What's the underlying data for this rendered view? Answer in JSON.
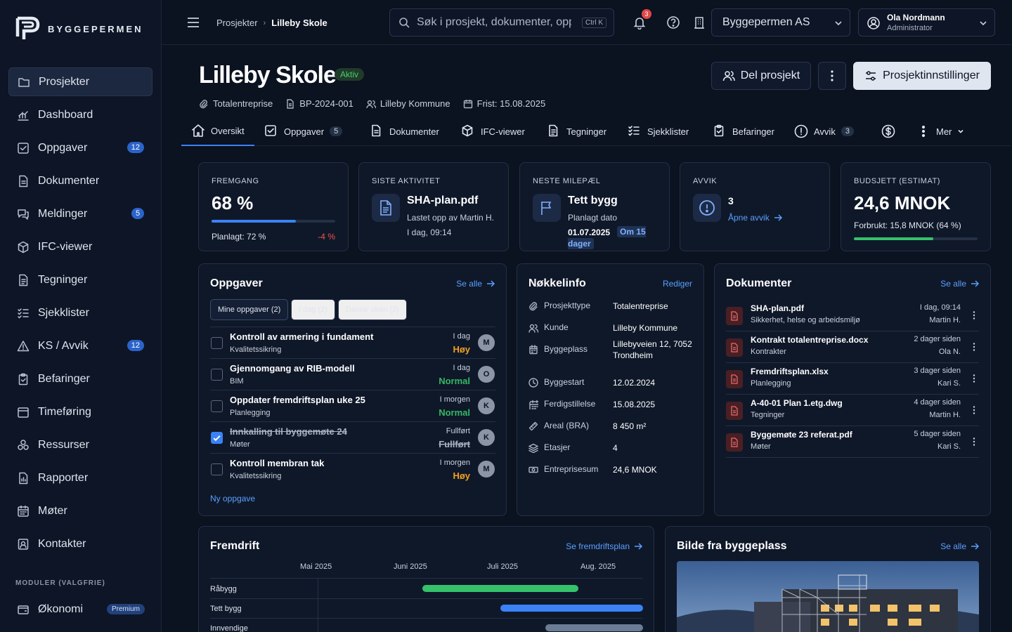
{
  "brand": {
    "name": "BYGGEPERMEN"
  },
  "sidebar": {
    "items": [
      {
        "label": "Prosjekter",
        "icon": "folder-icon",
        "active": true
      },
      {
        "label": "Dashboard",
        "icon": "chart-icon"
      },
      {
        "label": "Oppgaver",
        "icon": "checkbox-icon",
        "badge": "12"
      },
      {
        "label": "Dokumenter",
        "icon": "document-icon"
      },
      {
        "label": "Meldinger",
        "icon": "chat-icon",
        "badge": "5"
      },
      {
        "label": "IFC-viewer",
        "icon": "cube-icon"
      },
      {
        "label": "Tegninger",
        "icon": "drawing-icon"
      },
      {
        "label": "Sjekklister",
        "icon": "checklist-icon"
      },
      {
        "label": "KS / Avvik",
        "icon": "warning-icon",
        "badge": "12"
      },
      {
        "label": "Befaringer",
        "icon": "clipboard-icon"
      },
      {
        "label": "Timeføring",
        "icon": "timesheet-icon"
      },
      {
        "label": "Ressurser",
        "icon": "resources-icon"
      },
      {
        "label": "Rapporter",
        "icon": "report-icon"
      },
      {
        "label": "Møter",
        "icon": "calendar-icon"
      },
      {
        "label": "Kontakter",
        "icon": "contacts-icon"
      }
    ],
    "modules_label": "MODULER (VALGFRIE)",
    "module": {
      "label": "Økonomi",
      "badge": "Premium",
      "icon": "wallet-icon"
    }
  },
  "topbar": {
    "breadcrumb": [
      "Prosjekter",
      "Lilleby Skole"
    ],
    "search_placeholder": "Søk i prosjekt, dokumenter, oppgaver…",
    "search_shortcut": "Ctrl K",
    "notifications": "3",
    "company": "Byggepermen AS",
    "user": {
      "name": "Ola Nordmann",
      "role": "Administrator"
    }
  },
  "project": {
    "title": "Lilleby Skole",
    "status": "Aktiv",
    "share_label": "Del prosjekt",
    "settings_label": "Prosjektinnstillinger",
    "meta": {
      "contract": "Totalentreprise",
      "id": "BP-2024-001",
      "client": "Lilleby Kommune",
      "deadline": "Frist: 15.08.2025"
    }
  },
  "tabs": [
    {
      "label": "Oversikt",
      "icon": "home-icon",
      "active": true
    },
    {
      "label": "Oppgaver",
      "icon": "checkbox-icon",
      "count": "5"
    },
    {
      "label": "Dokumenter",
      "icon": "document-icon"
    },
    {
      "label": "IFC-viewer",
      "icon": "cube-icon"
    },
    {
      "label": "Tegninger",
      "icon": "drawing-icon"
    },
    {
      "label": "Sjekklister",
      "icon": "checklist-icon"
    },
    {
      "label": "Befaringer",
      "icon": "clipboard-icon"
    },
    {
      "label": "Avvik",
      "icon": "alert-icon",
      "count": "3"
    },
    {
      "label": "",
      "icon": "dollar-icon"
    },
    {
      "label": "Mer",
      "icon": "kebab-icon"
    }
  ],
  "kpi": {
    "progress": {
      "label": "FREMGANG",
      "value": "68 %",
      "fraction": 0.68,
      "planned": "Planlagt: 72 %",
      "delta": "-4 %"
    },
    "activity": {
      "label": "SISTE AKTIVITET",
      "file": "SHA-plan.pdf",
      "line1": "Lastet opp av Martin H.",
      "line2": "I dag, 09:14"
    },
    "milestone": {
      "label": "NESTE MILEPÆL",
      "title": "Tett bygg",
      "sub": "Planlagt dato",
      "date": "01.07.2025",
      "badge": "Om 15 dager"
    },
    "deviations": {
      "label": "AVVIK",
      "count": "3",
      "link": "Åpne avvik"
    },
    "budget": {
      "label": "BUDSJETT (ESTIMAT)",
      "value": "24,6 MNOK",
      "spent": "Forbrukt: 15,8 MNOK (64 %)",
      "fraction": 0.64
    }
  },
  "tasks": {
    "title": "Oppgaver",
    "see_all": "Se alle",
    "filters": [
      "Mine oppgaver (2)",
      "I dag (2)",
      "Denne uken (3)"
    ],
    "rows": [
      {
        "name": "Kontroll av armering i fundament",
        "category": "Kvalitetssikring",
        "due": "I dag",
        "priority": "Høy",
        "priority_color": "#f0a020",
        "avatar": "M",
        "done": false
      },
      {
        "name": "Gjennomgang av RIB-modell",
        "category": "BIM",
        "due": "I dag",
        "priority": "Normal",
        "priority_color": "#35b864",
        "avatar": "O",
        "done": false
      },
      {
        "name": "Oppdater fremdriftsplan uke 25",
        "category": "Planlegging",
        "due": "I morgen",
        "priority": "Normal",
        "priority_color": "#35b864",
        "avatar": "K",
        "done": false
      },
      {
        "name": "Innkalling til byggemøte 24",
        "category": "Møter",
        "due": "Fullført",
        "priority": "Fullført",
        "priority_color": "#aab3c2",
        "avatar": "K",
        "done": true
      },
      {
        "name": "Kontroll membran tak",
        "category": "Kvalitetssikring",
        "due": "I morgen",
        "priority": "Høy",
        "priority_color": "#f0a020",
        "avatar": "M",
        "done": false
      }
    ],
    "new_task": "Ny oppgave"
  },
  "keyinfo": {
    "title": "Nøkkelinfo",
    "edit": "Rediger",
    "rows": [
      {
        "label": "Prosjekttype",
        "value": "Totalentreprise",
        "icon": "paperclip-icon"
      },
      {
        "label": "Kunde",
        "value": "Lilleby Kommune",
        "icon": "users-icon"
      },
      {
        "label": "Byggeplass",
        "value": "Lilleby­veien 12, 7052 Trondheim",
        "icon": "building-icon"
      },
      {
        "label": "Byggestart",
        "value": "12.02.2024",
        "icon": "clock-icon"
      },
      {
        "label": "Ferdigstillelse",
        "value": "15.08.2025",
        "icon": "calendar-icon"
      },
      {
        "label": "Areal (BRA)",
        "value": "8 450 m²",
        "icon": "ruler-icon"
      },
      {
        "label": "Etasjer",
        "value": "4",
        "icon": "layers-icon"
      },
      {
        "label": "Entreprisesum",
        "value": "24,6 MNOK",
        "icon": "money-icon"
      }
    ]
  },
  "documents": {
    "title": "Dokumenter",
    "see_all": "Se alle",
    "rows": [
      {
        "name": "SHA-plan.pdf",
        "category": "Sikkerhet, helse og arbeidsmiljø",
        "time": "I dag, 09:14",
        "by": "Martin H."
      },
      {
        "name": "Kontrakt totalentreprise.docx",
        "category": "Kontrakter",
        "time": "2 dager siden",
        "by": "Ola N."
      },
      {
        "name": "Fremdriftsplan.xlsx",
        "category": "Planlegging",
        "time": "3 dager siden",
        "by": "Kari S."
      },
      {
        "name": "A-40-01 Plan 1.etg.dwg",
        "category": "Tegninger",
        "time": "4 dager siden",
        "by": "Martin H."
      },
      {
        "name": "Byggemøte 23 referat.pdf",
        "category": "Møter",
        "time": "5 dager siden",
        "by": "Kari S."
      }
    ]
  },
  "schedule": {
    "title": "Fremdrift",
    "link": "Se fremdriftsplan",
    "months": [
      "Mai 2025",
      "Juni 2025",
      "Juli 2025",
      "Aug. 2025"
    ],
    "rows": [
      {
        "label": "Råbygg",
        "start": 0.32,
        "end": 0.8,
        "color": "#35c26a"
      },
      {
        "label": "Tett bygg",
        "start": 0.56,
        "end": 1.0,
        "color": "#3b82f6"
      },
      {
        "label": "Innvendige",
        "start": 0.7,
        "end": 1.0,
        "color": "#6b7c95"
      }
    ]
  },
  "site_photo": {
    "title": "Bilde fra byggeplass",
    "see_all": "Se alle"
  }
}
